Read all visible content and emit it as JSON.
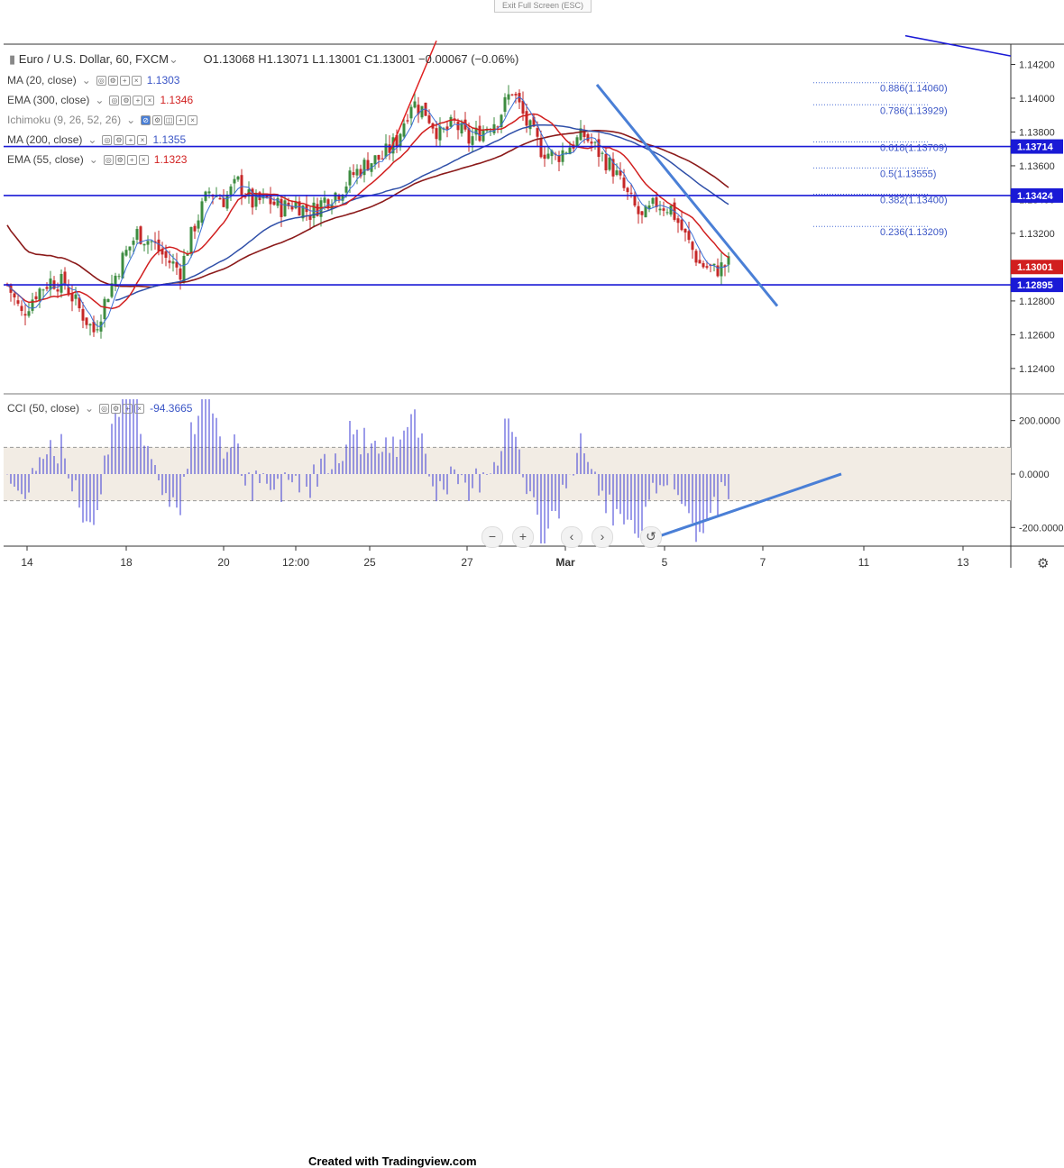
{
  "toolbar": {
    "exit_label": "Exit Full Screen (ESC)"
  },
  "header": {
    "symbol": "Euro / U.S. Dollar, 60, FXCM",
    "ohlc": "O1.13068  H1.13071  L1.13001  C1.13001  −0.00067 (−0.06%)"
  },
  "indicators": [
    {
      "label": "MA (20, close)",
      "value": "1.1303",
      "color": "#3a55c6"
    },
    {
      "label": "EMA (300, close)",
      "value": "1.1346",
      "color": "#d11f1f"
    },
    {
      "label": "Ichimoku (9, 26, 52, 26)",
      "value": "",
      "color": "#3a55c6"
    },
    {
      "label": "MA (200, close)",
      "value": "1.1355",
      "color": "#3a55c6"
    },
    {
      "label": "EMA (55, close)",
      "value": "1.1323",
      "color": "#d11f1f"
    }
  ],
  "cci": {
    "label": "CCI (50, close)",
    "value": "-94.3665"
  },
  "footer": {
    "credit": "Created with Tradingview.com"
  },
  "colors": {
    "up": "#3d8c40",
    "down": "#c62828",
    "level": "#1a1ad6",
    "trend": "#4a7fd6",
    "ma200": "#8b1a1a",
    "ema55": "#d11f1f",
    "ma20": "#3a6fd6",
    "ema300": "#2f4fa8"
  },
  "chart_data": [
    {
      "type": "candlestick",
      "title": "Euro / U.S. Dollar, 60, FXCM",
      "ylim": [
        1.1225,
        1.1432
      ],
      "y_ticks": [
        "1.14200",
        "1.14000",
        "1.13800",
        "1.13600",
        "1.13400",
        "1.13200",
        "1.13000",
        "1.12800",
        "1.12600",
        "1.12400"
      ],
      "x_ticks": [
        "14",
        "18",
        "20",
        "12:00",
        "25",
        "27",
        "Mar",
        "5",
        "7",
        "11",
        "13"
      ],
      "price_labels": [
        {
          "text": "1.13714",
          "value": 1.13714,
          "color": "#1a1ad6"
        },
        {
          "text": "1.13424",
          "value": 1.13424,
          "color": "#1a1ad6"
        },
        {
          "text": "1.13001",
          "value": 1.13001,
          "color": "#d11f1f"
        },
        {
          "text": "1.12895",
          "value": 1.12895,
          "color": "#1a1ad6"
        }
      ],
      "horizontal_levels": [
        1.13714,
        1.13424,
        1.12895
      ],
      "fib_levels": [
        {
          "label": "0.886(1.14060)",
          "value": 1.1406
        },
        {
          "label": "0.786(1.13929)",
          "value": 1.13929
        },
        {
          "label": "0.618(1.13709)",
          "value": 1.13709
        },
        {
          "label": "0.5(1.13555)",
          "value": 1.13555
        },
        {
          "label": "0.382(1.13400)",
          "value": 1.134
        },
        {
          "label": "0.236(1.13209)",
          "value": 1.13209
        }
      ],
      "close_anchors": [
        [
          0,
          1.129
        ],
        [
          4,
          1.1272
        ],
        [
          8,
          1.1285
        ],
        [
          12,
          1.1292
        ],
        [
          16,
          1.129
        ],
        [
          20,
          1.1275
        ],
        [
          24,
          1.1262
        ],
        [
          28,
          1.1285
        ],
        [
          32,
          1.1305
        ],
        [
          36,
          1.132
        ],
        [
          40,
          1.1315
        ],
        [
          44,
          1.1305
        ],
        [
          48,
          1.1298
        ],
        [
          52,
          1.1325
        ],
        [
          56,
          1.1345
        ],
        [
          60,
          1.134
        ],
        [
          64,
          1.135
        ],
        [
          68,
          1.1338
        ],
        [
          72,
          1.134
        ],
        [
          76,
          1.1335
        ],
        [
          80,
          1.1338
        ],
        [
          84,
          1.1332
        ],
        [
          88,
          1.134
        ],
        [
          92,
          1.1345
        ],
        [
          96,
          1.1355
        ],
        [
          100,
          1.1362
        ],
        [
          104,
          1.1365
        ],
        [
          108,
          1.1375
        ],
        [
          112,
          1.1398
        ],
        [
          116,
          1.1392
        ],
        [
          120,
          1.1378
        ],
        [
          124,
          1.1385
        ],
        [
          128,
          1.1375
        ],
        [
          132,
          1.1382
        ],
        [
          136,
          1.1388
        ],
        [
          140,
          1.1405
        ],
        [
          144,
          1.1385
        ],
        [
          148,
          1.137
        ],
        [
          152,
          1.1365
        ],
        [
          156,
          1.1372
        ],
        [
          160,
          1.1378
        ],
        [
          164,
          1.1368
        ],
        [
          168,
          1.1358
        ],
        [
          172,
          1.1342
        ],
        [
          176,
          1.1328
        ],
        [
          180,
          1.1338
        ],
        [
          184,
          1.1335
        ],
        [
          188,
          1.1318
        ],
        [
          192,
          1.1302
        ],
        [
          196,
          1.1298
        ],
        [
          200,
          1.1302
        ]
      ]
    },
    {
      "type": "bar",
      "title": "CCI (50, close)",
      "ylim": [
        -270,
        290
      ],
      "y_ticks": [
        "200.0000",
        "0.0000",
        "-200.0000"
      ],
      "band": [
        -100,
        100
      ],
      "last_value": -94.3665
    }
  ]
}
